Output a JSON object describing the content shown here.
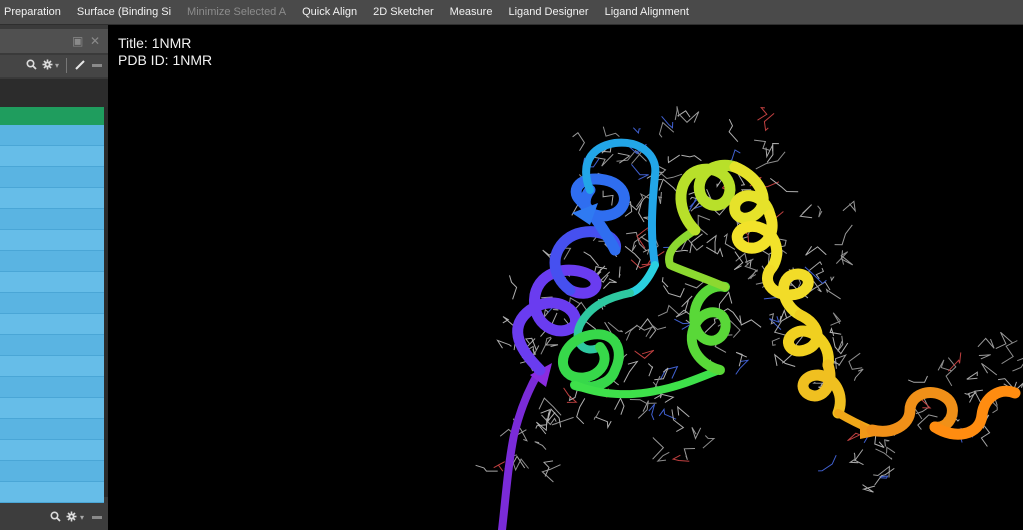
{
  "menubar": {
    "items": [
      {
        "label": "Preparation",
        "enabled": true
      },
      {
        "label": "Surface (Binding Si",
        "enabled": true
      },
      {
        "label": "Minimize Selected A",
        "enabled": false
      },
      {
        "label": "Quick Align",
        "enabled": true
      },
      {
        "label": "2D Sketcher",
        "enabled": true
      },
      {
        "label": "Measure",
        "enabled": true
      },
      {
        "label": "Ligand Designer",
        "enabled": true
      },
      {
        "label": "Ligand Alignment",
        "enabled": true
      }
    ]
  },
  "left_panel": {
    "toolbar_icons": [
      "search-icon",
      "gear-icon",
      "chevron-down-icon",
      "pencil-icon",
      "minimize-icon"
    ],
    "header_color": "#1f9d5e",
    "row_color": "#5ab4e2"
  },
  "viewport": {
    "title_line": "Title: 1NMR",
    "pdb_line": "PDB ID: 1NMR",
    "ribbon_colors": [
      "#7a2bd8",
      "#6a3cf0",
      "#2f6ef0",
      "#22a6e8",
      "#2ad0e0",
      "#37d84a",
      "#b8e02a",
      "#f2e22a",
      "#f0c020",
      "#f09018",
      "#ff8c10"
    ]
  }
}
